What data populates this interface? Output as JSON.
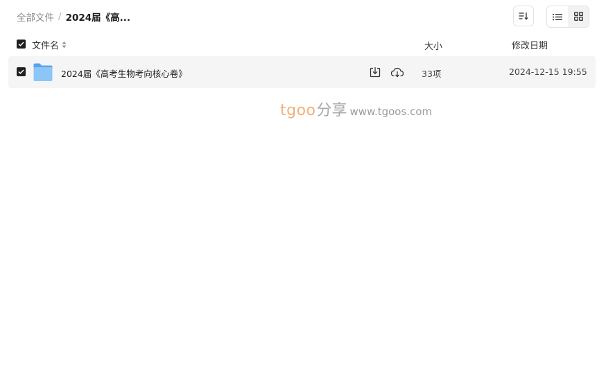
{
  "breadcrumb": {
    "root": "全部文件",
    "separator": "/",
    "current": "2024届《高..."
  },
  "toolbar": {
    "sort_icon": "sort-list-icon",
    "view_list_icon": "list-view-icon",
    "view_grid_icon": "grid-view-icon",
    "active_view": "list"
  },
  "columns": {
    "name": "文件名",
    "size": "大小",
    "date": "修改日期"
  },
  "files": [
    {
      "name": "2024届《高考生物考向核心卷》",
      "type": "folder",
      "size": "33项",
      "modified": "2024-12-15 19:55",
      "selected": true
    }
  ],
  "watermark": {
    "brand": "tgoo",
    "share": "分享",
    "url": "www.tgoos.com"
  },
  "colors": {
    "checkbox": "#1f1f1f",
    "row_highlight": "#f5f5f5",
    "folder": "#6fb3f2",
    "watermark_brand": "#f2b07a"
  }
}
